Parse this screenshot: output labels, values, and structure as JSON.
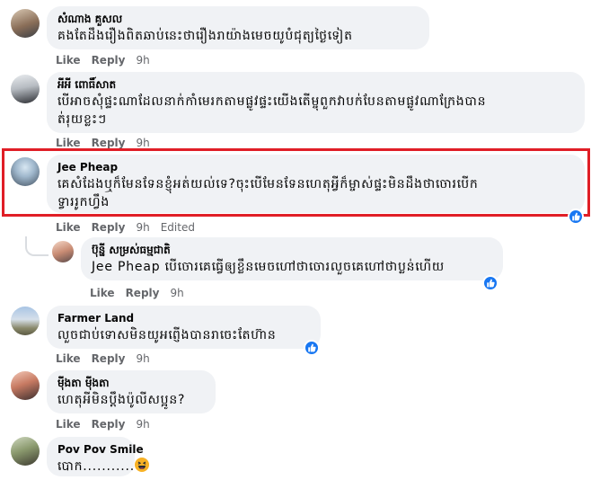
{
  "comments": [
    {
      "name": "សំណាង គួសល",
      "lines": [
        "គងតែដឹងរឿងពិតឆាប់នេះថារឿងរាយ៉ាងមេចយូបំជុត្យថ្ងៃទៀត"
      ],
      "like": "Like",
      "reply": "Reply",
      "time": "9h"
    },
    {
      "name": "អីអី ពោធិ៍សាត",
      "lines": [
        "បើអាចសុំផ្ទះណាដែលនាក់កាំមេរកតាមផ្លូវផ្ទះយើងតើម្ចុពួកវាបក់បែនតាមផ្លូវណាក្រែងបាន",
        "ត់រុយខ្លះៗ"
      ],
      "like": "Like",
      "reply": "Reply",
      "time": "9h"
    },
    {
      "name": "Jee Pheap",
      "lines": [
        "គេសំដែងឬក៏មែនទែនខ្ញុំអត់យល់ទេ?ចុះបើមែនទែនហេតុអ្វីក៏ម្ចាស់ផ្ទះមិនដឹងថាចោរបើក",
        "ទ្វាររូកហ្វឹង"
      ],
      "like": "Like",
      "reply": "Reply",
      "time": "9h",
      "edited": "Edited"
    },
    {
      "name": "ប៊ុន្នី សម្រស់ធម្មជាតិ",
      "mention": "Jee Pheap",
      "lines": [
        " បើចោរគេធ្វើឲ្យខ្លឹនមេចហៅថាចោរលួចគេហៅថាប្លន់ហើយ"
      ],
      "like": "Like",
      "reply": "Reply",
      "time": "9h"
    },
    {
      "name": "Farmer Land",
      "lines": [
        "លួចជាប់ទោសមិនយូអព្ញើងបានរាចេះតែហ៊ាន"
      ],
      "like": "Like",
      "reply": "Reply",
      "time": "9h"
    },
    {
      "name": "ម៉ីងតា ម៉ីងតា",
      "lines": [
        "ហេតុអីមិនប្ដឹងប៉ូលីសប្អូន?"
      ],
      "like": "Like",
      "reply": "Reply",
      "time": "9h"
    },
    {
      "name": "Pov Pov Smile",
      "lines": [
        "បោក..........."
      ]
    }
  ],
  "colors": {
    "bubble": "#f0f2f5",
    "like_blue": "#1877f2",
    "highlight": "#e01e26"
  }
}
